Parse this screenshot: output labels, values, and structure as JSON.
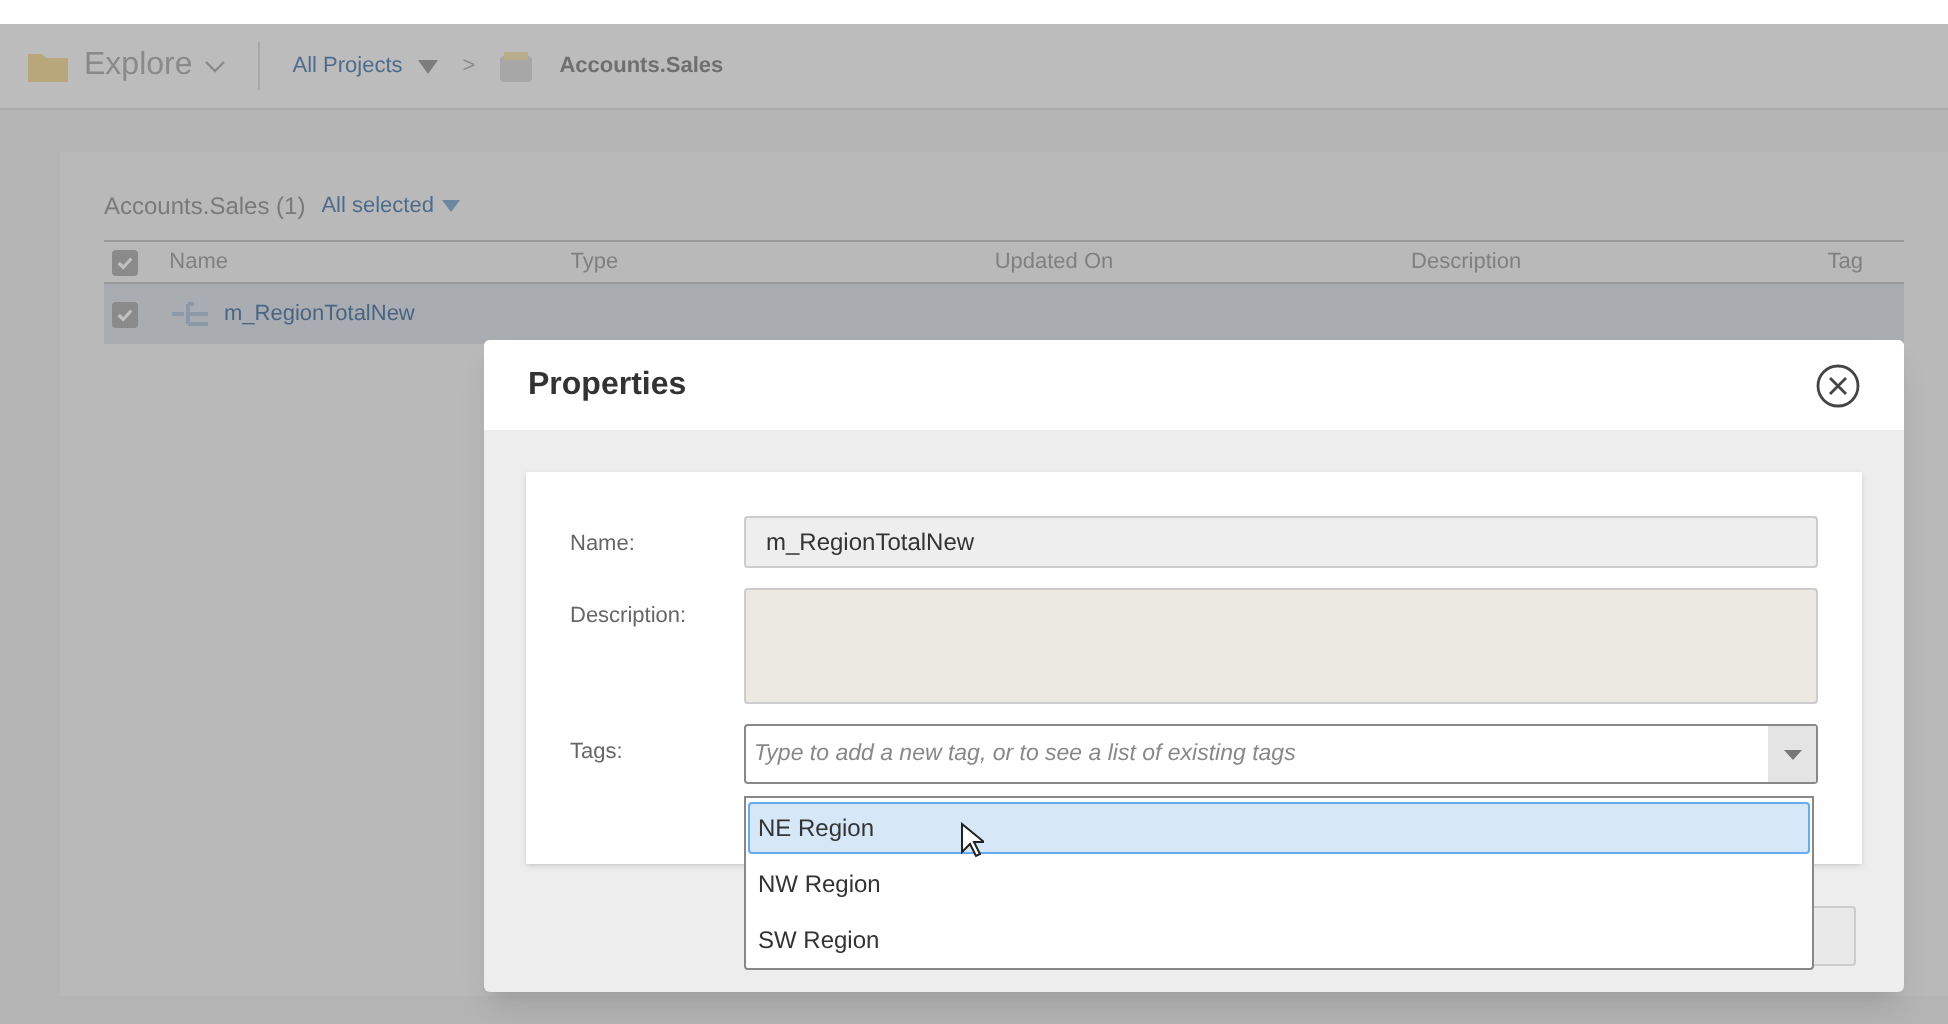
{
  "header": {
    "app_menu": "Explore",
    "breadcrumb": [
      {
        "label": "All Projects"
      },
      {
        "label": "Accounts.Sales"
      }
    ],
    "separator": ">"
  },
  "list": {
    "title": "Accounts.Sales (1)",
    "selection": "All selected",
    "header_checked": true,
    "columns": [
      "Name",
      "Type",
      "Updated On",
      "Description",
      "Tag"
    ],
    "rows": [
      {
        "name": "m_RegionTotalNew",
        "checked": true,
        "selected": true
      }
    ]
  },
  "dialog": {
    "title": "Properties",
    "fields": [
      {
        "kind": "text",
        "label": "Name:",
        "value": "m_RegionTotalNew"
      },
      {
        "kind": "textarea",
        "label": "Description:"
      },
      {
        "kind": "combo",
        "label": "Tags:",
        "placeholder": "Type to add a new tag, or to see a list of existing tags"
      }
    ],
    "options": [
      {
        "label": "NE Region",
        "selected": true
      },
      {
        "label": "NW Region",
        "selected": false
      },
      {
        "label": "SW Region",
        "selected": false
      }
    ]
  }
}
